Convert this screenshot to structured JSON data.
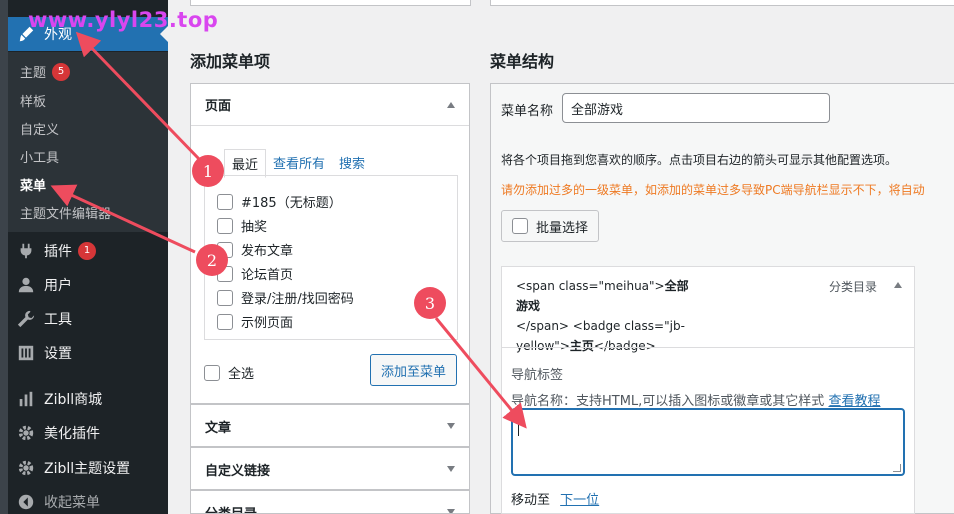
{
  "watermark": "www.ylyl23.top",
  "sidebar": {
    "appearance": "外观",
    "submenu": [
      {
        "label": "主题",
        "count": "5"
      },
      {
        "label": "样板"
      },
      {
        "label": "自定义"
      },
      {
        "label": "小工具"
      },
      {
        "label": "菜单"
      },
      {
        "label": "主题文件编辑器"
      }
    ],
    "items": [
      {
        "label": "插件",
        "count": "1"
      },
      {
        "label": "用户"
      },
      {
        "label": "工具"
      },
      {
        "label": "设置"
      },
      {
        "label": "Zibll商城"
      },
      {
        "label": "美化插件"
      },
      {
        "label": "Zibll主题设置"
      },
      {
        "label": "收起菜单"
      }
    ]
  },
  "add_items": {
    "heading": "添加菜单项",
    "pages_panel": {
      "title": "页面",
      "tabs": [
        "最近",
        "查看所有",
        "搜索"
      ],
      "pages": [
        "#185（无标题）",
        "抽奖",
        "发布文章",
        "论坛首页",
        "登录/注册/找回密码",
        "示例页面"
      ],
      "select_all": "全选",
      "add_button": "添加至菜单"
    },
    "posts_panel": "文章",
    "custom_links_panel": "自定义链接",
    "categories_panel": "分类目录"
  },
  "structure": {
    "heading": "菜单结构",
    "name_label": "菜单名称",
    "name_value": "全部游戏",
    "instructions": "将各个项目拖到您喜欢的顺序。点击项目右边的箭头可显示其他配置选项。",
    "warning": "请勿添加过多的一级菜单，如添加的菜单过多导致PC端导航栏显示不下，将自动",
    "bulk_select": "批量选择",
    "item": {
      "title_line1": "<span class=\"meihua\">",
      "title_bold1": "全部游戏",
      "title_line2": "</span> <badge class=\"jb-",
      "title_line3": "yellow\">",
      "title_bold2": "主页",
      "title_line3_end": "</badge>",
      "type": "分类目录",
      "nav_label": "导航标签",
      "nav_hint": "导航名称：支持HTML,可以插入图标或徽章或其它样式",
      "nav_hint_link": "查看教程",
      "textarea_value": "",
      "move_label": "移动至",
      "move_link": "下一位"
    }
  },
  "annotations": [
    "1",
    "2",
    "3"
  ],
  "colors": {
    "sidebar_bg": "#1d2327",
    "accent": "#2271b1",
    "warning": "#ee7a23",
    "annotation": "#ee4c5e"
  }
}
